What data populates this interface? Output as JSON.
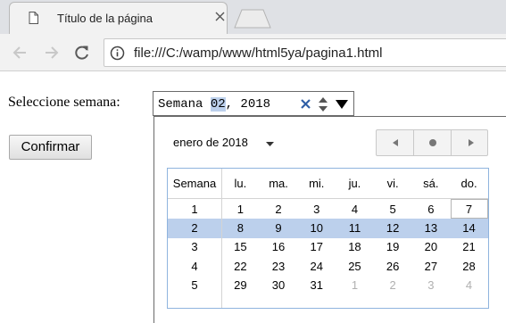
{
  "browser": {
    "tab_title": "Título de la página",
    "url": "file:///C:/wamp/www/html5ya/pagina1.html"
  },
  "form": {
    "label": "Seleccione semana:",
    "week_prefix": "Semana ",
    "week_number": "02",
    "week_suffix": ", 2018",
    "confirm_label": "Confirmar"
  },
  "calendar": {
    "month_label": "enero de 2018",
    "week_header": "Semana",
    "day_headers": [
      "lu.",
      "ma.",
      "mi.",
      "ju.",
      "vi.",
      "sá.",
      "do."
    ],
    "selected_week": 2,
    "today": "7",
    "selection_color": "#bcd0ec",
    "weeks": [
      {
        "week": "1",
        "days": [
          "1",
          "2",
          "3",
          "4",
          "5",
          "6",
          "7"
        ]
      },
      {
        "week": "2",
        "days": [
          "8",
          "9",
          "10",
          "11",
          "12",
          "13",
          "14"
        ]
      },
      {
        "week": "3",
        "days": [
          "15",
          "16",
          "17",
          "18",
          "19",
          "20",
          "21"
        ]
      },
      {
        "week": "4",
        "days": [
          "22",
          "23",
          "24",
          "25",
          "26",
          "27",
          "28"
        ]
      },
      {
        "week": "5",
        "days": [
          "29",
          "30",
          "31",
          "1",
          "2",
          "3",
          "4"
        ]
      }
    ],
    "other_month_start": [
      4,
      3
    ]
  }
}
